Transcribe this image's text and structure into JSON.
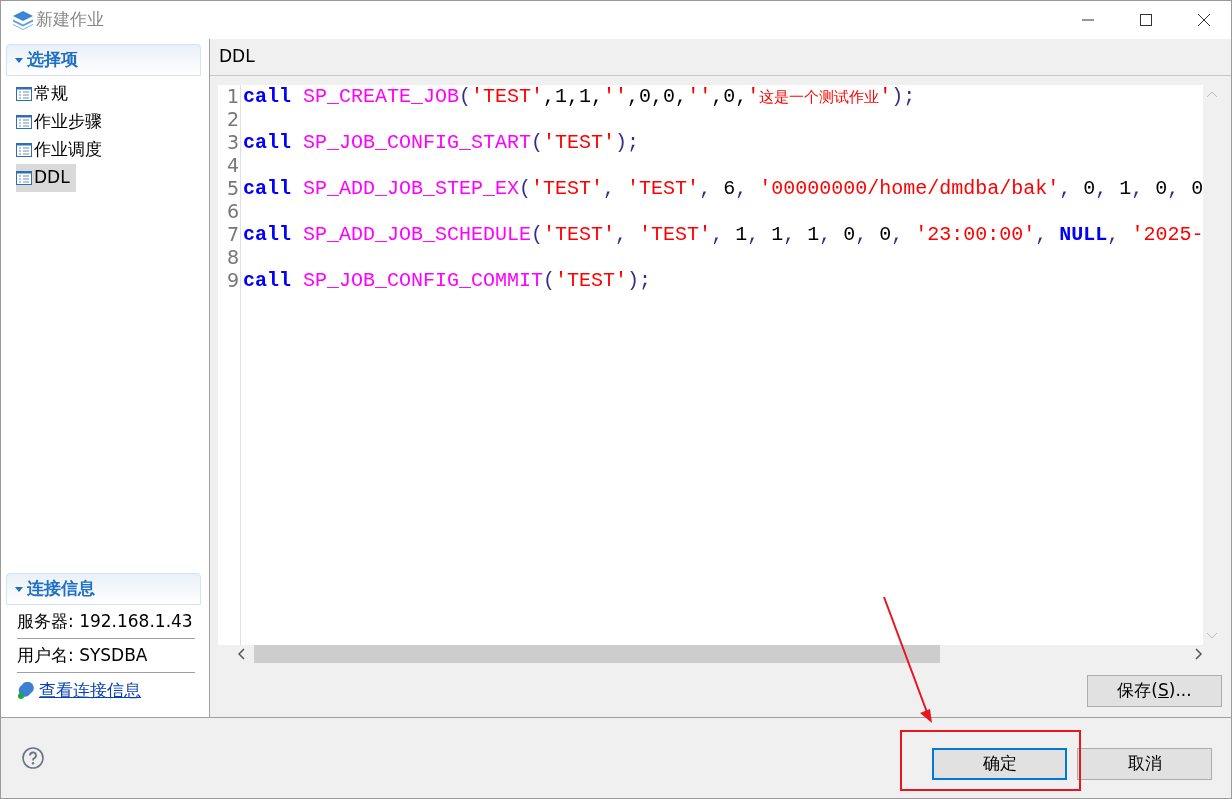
{
  "window": {
    "title": "新建作业"
  },
  "sidebar": {
    "sections": [
      {
        "title": "选择项",
        "expanded": true,
        "items": [
          {
            "label": "常规",
            "selected": false
          },
          {
            "label": "作业步骤",
            "selected": false
          },
          {
            "label": "作业调度",
            "selected": false
          },
          {
            "label": "DDL",
            "selected": true
          }
        ]
      },
      {
        "title": "连接信息",
        "expanded": true,
        "info": [
          "服务器: 192.168.1.43",
          "用户名: SYSDBA"
        ],
        "link": "查看连接信息"
      }
    ]
  },
  "panel": {
    "title": "DDL",
    "code": [
      {
        "number": "1",
        "tokens": [
          {
            "kind": "keyword",
            "text": "call"
          },
          {
            "kind": "func",
            "text": "SP_CREATE_JOB"
          },
          {
            "kind": "punct",
            "text": "("
          },
          {
            "kind": "string",
            "text": "'TEST'"
          },
          {
            "kind": "number",
            "text": ",1,1,"
          },
          {
            "kind": "string",
            "text": "''"
          },
          {
            "kind": "number",
            "text": ",0,0,"
          },
          {
            "kind": "string",
            "text": "''"
          },
          {
            "kind": "number",
            "text": ",0,"
          },
          {
            "kind": "string",
            "text": "'"
          },
          {
            "kind": "cjk",
            "text": "这是一个测试作业"
          },
          {
            "kind": "string",
            "text": "'"
          },
          {
            "kind": "punct",
            "text": ");"
          }
        ]
      },
      {
        "number": "2"
      },
      {
        "number": "3",
        "tokens": [
          {
            "kind": "keyword",
            "text": "call"
          },
          {
            "kind": "func",
            "text": "SP_JOB_CONFIG_START"
          },
          {
            "kind": "punct",
            "text": "("
          },
          {
            "kind": "string",
            "text": "'TEST'"
          },
          {
            "kind": "punct",
            "text": ");"
          }
        ]
      },
      {
        "number": "4"
      },
      {
        "number": "5",
        "tokens": [
          {
            "kind": "keyword",
            "text": "call"
          },
          {
            "kind": "func",
            "text": "SP_ADD_JOB_STEP_EX"
          },
          {
            "kind": "punct",
            "text": "("
          },
          {
            "kind": "string",
            "text": "'TEST'"
          },
          {
            "kind": "punct",
            "text": ", "
          },
          {
            "kind": "string",
            "text": "'TEST'"
          },
          {
            "kind": "punct",
            "text": ", "
          },
          {
            "kind": "number",
            "text": "6"
          },
          {
            "kind": "punct",
            "text": ", "
          },
          {
            "kind": "string",
            "text": "'00000000/home/dmdba/bak'"
          },
          {
            "kind": "punct",
            "text": ", "
          },
          {
            "kind": "number",
            "text": "0"
          },
          {
            "kind": "punct",
            "text": ", "
          },
          {
            "kind": "number",
            "text": "1"
          },
          {
            "kind": "punct",
            "text": ", "
          },
          {
            "kind": "number",
            "text": "0"
          },
          {
            "kind": "punct",
            "text": ", "
          },
          {
            "kind": "number",
            "text": "0"
          }
        ]
      },
      {
        "number": "6"
      },
      {
        "number": "7",
        "tokens": [
          {
            "kind": "keyword",
            "text": "call"
          },
          {
            "kind": "func",
            "text": "SP_ADD_JOB_SCHEDULE"
          },
          {
            "kind": "punct",
            "text": "("
          },
          {
            "kind": "string",
            "text": "'TEST'"
          },
          {
            "kind": "punct",
            "text": ", "
          },
          {
            "kind": "string",
            "text": "'TEST'"
          },
          {
            "kind": "punct",
            "text": ", "
          },
          {
            "kind": "number",
            "text": "1"
          },
          {
            "kind": "punct",
            "text": ", "
          },
          {
            "kind": "number",
            "text": "1"
          },
          {
            "kind": "punct",
            "text": ", "
          },
          {
            "kind": "number",
            "text": "1"
          },
          {
            "kind": "punct",
            "text": ", "
          },
          {
            "kind": "number",
            "text": "0"
          },
          {
            "kind": "punct",
            "text": ", "
          },
          {
            "kind": "number",
            "text": "0"
          },
          {
            "kind": "punct",
            "text": ", "
          },
          {
            "kind": "string",
            "text": "'23:00:00'"
          },
          {
            "kind": "punct",
            "text": ", "
          },
          {
            "kind": "keyword",
            "text": "NULL"
          },
          {
            "kind": "punct",
            "text": ", "
          },
          {
            "kind": "string",
            "text": "'2025-"
          }
        ]
      },
      {
        "number": "8"
      },
      {
        "number": "9",
        "tokens": [
          {
            "kind": "keyword",
            "text": "call"
          },
          {
            "kind": "func",
            "text": "SP_JOB_CONFIG_COMMIT"
          },
          {
            "kind": "punct",
            "text": "("
          },
          {
            "kind": "string",
            "text": "'TEST'"
          },
          {
            "kind": "punct",
            "text": ");"
          }
        ]
      }
    ],
    "save_button": {
      "before": "保存(",
      "mnemonic": "S",
      "after": ")..."
    }
  },
  "footer": {
    "buttons": [
      {
        "label": "确定",
        "default": true
      },
      {
        "label": "取消",
        "default": false
      }
    ]
  }
}
